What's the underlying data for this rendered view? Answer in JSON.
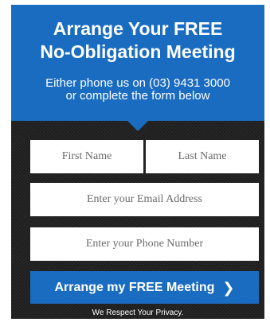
{
  "header": {
    "title": "Arrange Your FREE\nNo-Obligation Meeting",
    "subtitle": "Either phone us on (03) 9431 3000\nor complete the form below"
  },
  "form": {
    "first_name_placeholder": "First Name",
    "last_name_placeholder": "Last Name",
    "email_placeholder": "Enter your Email Address",
    "phone_placeholder": "Enter your Phone Number",
    "submit_label": "Arrange my FREE Meeting",
    "submit_icon": "chevron-right-icon",
    "privacy_note": "We Respect Your Privacy."
  },
  "colors": {
    "accent": "#1a6cc0",
    "panel": "#232323"
  }
}
